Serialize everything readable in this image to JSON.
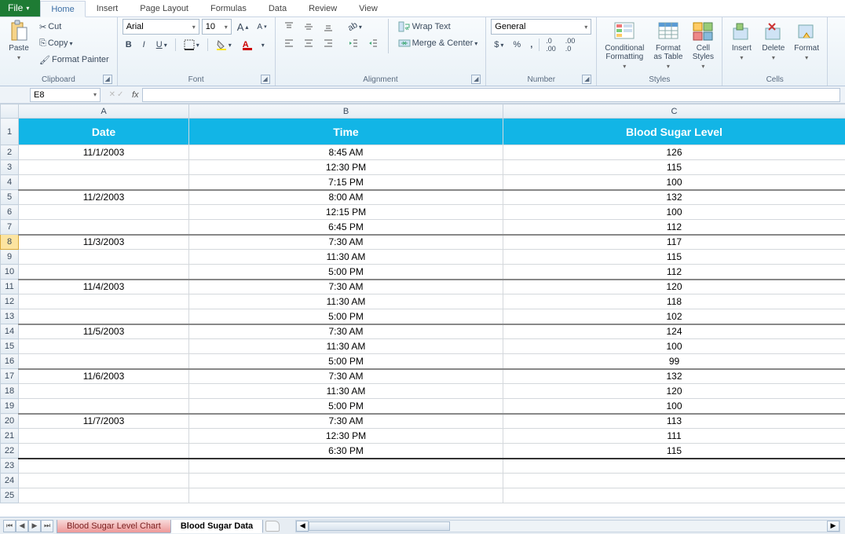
{
  "tabs": {
    "file": "File",
    "home": "Home",
    "insert": "Insert",
    "page_layout": "Page Layout",
    "formulas": "Formulas",
    "data": "Data",
    "review": "Review",
    "view": "View"
  },
  "clipboard": {
    "paste": "Paste",
    "cut": "Cut",
    "copy": "Copy",
    "format_painter": "Format Painter",
    "label": "Clipboard"
  },
  "font": {
    "name": "Arial",
    "size": "10",
    "label": "Font"
  },
  "alignment": {
    "wrap": "Wrap Text",
    "merge": "Merge & Center",
    "label": "Alignment"
  },
  "number": {
    "format": "General",
    "label": "Number"
  },
  "styles": {
    "conditional": "Conditional\nFormatting",
    "table": "Format\nas Table",
    "cell": "Cell\nStyles",
    "label": "Styles"
  },
  "cells": {
    "insert": "Insert",
    "delete": "Delete",
    "format": "Format",
    "label": "Cells"
  },
  "name_box": "E8",
  "formula": "",
  "columns": [
    "A",
    "B",
    "C"
  ],
  "header_row": {
    "date": "Date",
    "time": "Time",
    "level": "Blood Sugar Level"
  },
  "rows": [
    {
      "n": 2,
      "date": "11/1/2003",
      "time": "8:45 AM",
      "level": "126"
    },
    {
      "n": 3,
      "date": "",
      "time": "12:30 PM",
      "level": "115"
    },
    {
      "n": 4,
      "date": "",
      "time": "7:15 PM",
      "level": "100",
      "thick": true
    },
    {
      "n": 5,
      "date": "11/2/2003",
      "time": "8:00 AM",
      "level": "132"
    },
    {
      "n": 6,
      "date": "",
      "time": "12:15 PM",
      "level": "100"
    },
    {
      "n": 7,
      "date": "",
      "time": "6:45 PM",
      "level": "112",
      "thick": true
    },
    {
      "n": 8,
      "date": "11/3/2003",
      "time": "7:30 AM",
      "level": "117",
      "sel": true
    },
    {
      "n": 9,
      "date": "",
      "time": "11:30 AM",
      "level": "115"
    },
    {
      "n": 10,
      "date": "",
      "time": "5:00 PM",
      "level": "112",
      "thick": true
    },
    {
      "n": 11,
      "date": "11/4/2003",
      "time": "7:30 AM",
      "level": "120"
    },
    {
      "n": 12,
      "date": "",
      "time": "11:30 AM",
      "level": "118"
    },
    {
      "n": 13,
      "date": "",
      "time": "5:00 PM",
      "level": "102",
      "thick": true
    },
    {
      "n": 14,
      "date": "11/5/2003",
      "time": "7:30 AM",
      "level": "124"
    },
    {
      "n": 15,
      "date": "",
      "time": "11:30 AM",
      "level": "100"
    },
    {
      "n": 16,
      "date": "",
      "time": "5:00 PM",
      "level": "99",
      "thick": true
    },
    {
      "n": 17,
      "date": "11/6/2003",
      "time": "7:30 AM",
      "level": "132"
    },
    {
      "n": 18,
      "date": "",
      "time": "11:30 AM",
      "level": "120"
    },
    {
      "n": 19,
      "date": "",
      "time": "5:00 PM",
      "level": "100",
      "thick": true
    },
    {
      "n": 20,
      "date": "11/7/2003",
      "time": "7:30 AM",
      "level": "113"
    },
    {
      "n": 21,
      "date": "",
      "time": "12:30 PM",
      "level": "111"
    },
    {
      "n": 22,
      "date": "",
      "time": "6:30 PM",
      "level": "115",
      "last": true
    },
    {
      "n": 23,
      "date": "",
      "time": "",
      "level": ""
    },
    {
      "n": 24,
      "date": "",
      "time": "",
      "level": ""
    },
    {
      "n": 25,
      "date": "",
      "time": "",
      "level": ""
    }
  ],
  "sheets": {
    "chart": "Blood Sugar Level Chart",
    "data": "Blood Sugar Data"
  }
}
